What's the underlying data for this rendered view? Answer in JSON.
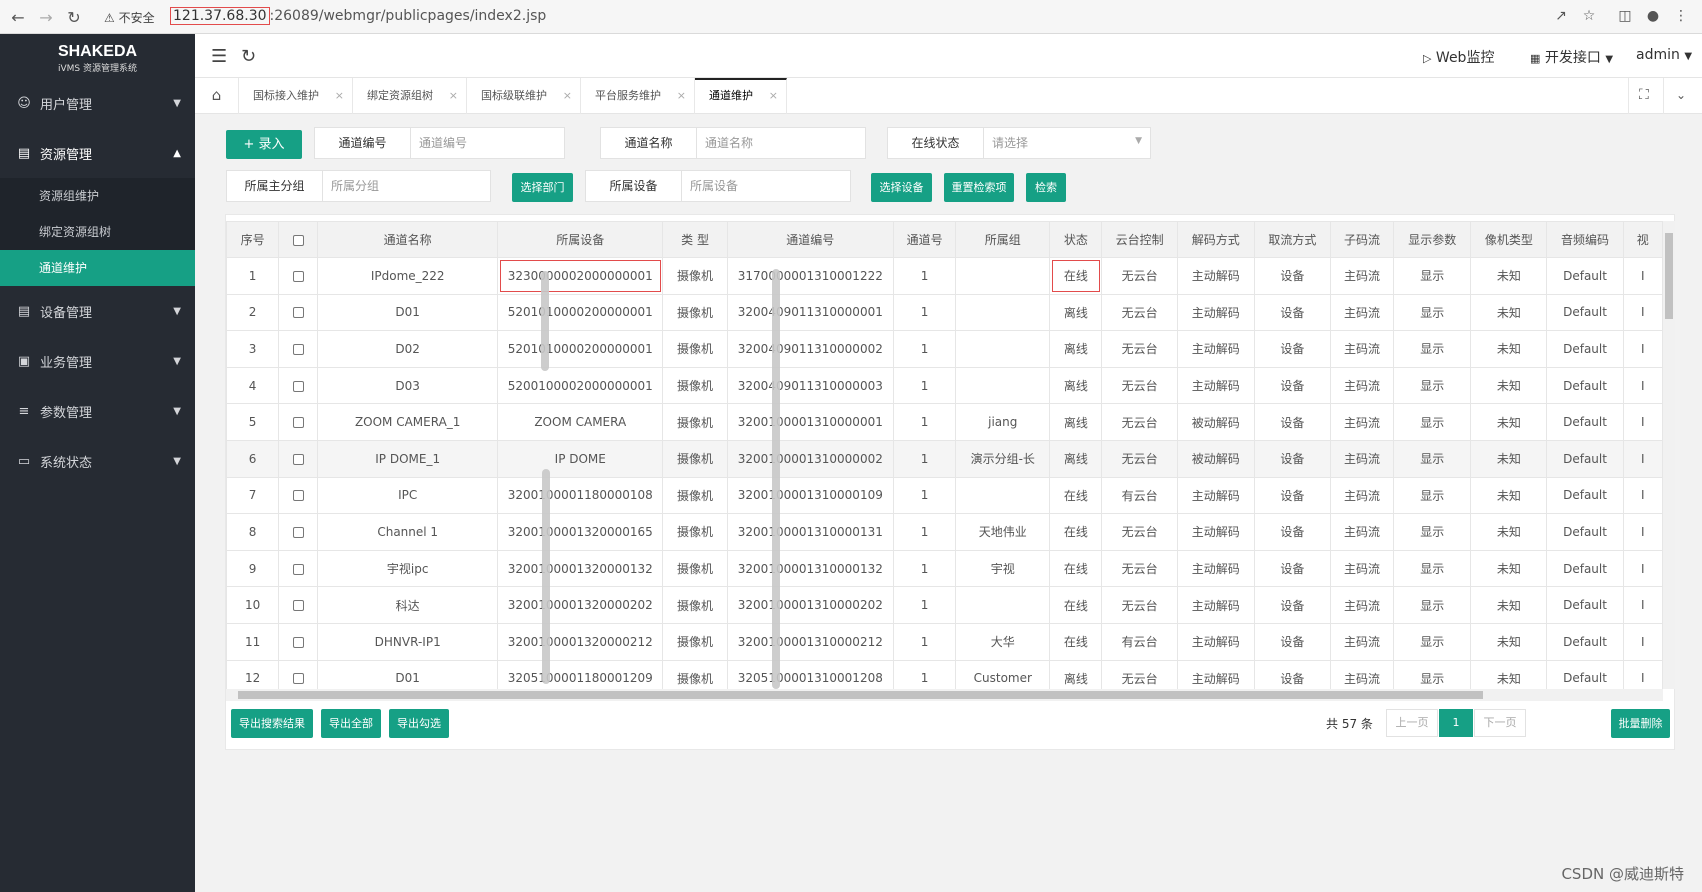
{
  "browser": {
    "back_icon": "arrow-left-icon",
    "forward_icon": "arrow-right-icon",
    "reload_icon": "reload-icon",
    "security_label": "不安全",
    "url_host": "121.37.68.30",
    "url_rest": ":26089/webmgr/publicpages/index2.jsp"
  },
  "sidebar": {
    "logo_main": "SHAKEDA",
    "logo_sub": "iVMS 资源管理系统",
    "items": [
      {
        "label": "用户管理",
        "icon": "user-icon"
      },
      {
        "label": "资源管理",
        "icon": "folder-icon"
      },
      {
        "label": "设备管理",
        "icon": "device-icon"
      },
      {
        "label": "业务管理",
        "icon": "business-icon"
      },
      {
        "label": "参数管理",
        "icon": "sliders-icon"
      },
      {
        "label": "系统状态",
        "icon": "monitor-icon"
      }
    ],
    "subitems": [
      "资源组维护",
      "绑定资源组树",
      "通道维护"
    ],
    "active_sub": "通道维护"
  },
  "topbar": {
    "web_monitor": "Web监控",
    "dev_interface": "开发接口",
    "user": "admin"
  },
  "tabs": [
    "国标接入维护",
    "绑定资源组树",
    "国标级联维护",
    "平台服务维护",
    "通道维护"
  ],
  "active_tab": "通道维护",
  "filters": {
    "add_button": "+ 录入",
    "channel_no_label": "通道编号",
    "channel_no_placeholder": "通道编号",
    "channel_name_label": "通道名称",
    "channel_name_placeholder": "通道名称",
    "online_label": "在线状态",
    "online_placeholder": "请选择",
    "group_label": "所属主分组",
    "group_placeholder": "所属分组",
    "select_dept": "选择部门",
    "device_label": "所属设备",
    "device_placeholder": "所属设备",
    "select_device": "选择设备",
    "reset": "重置检索项",
    "search": "检索"
  },
  "table": {
    "headers": [
      "序号",
      "",
      "通道名称",
      "所属设备",
      "类 型",
      "通道编号",
      "通道号",
      "所属组",
      "状态",
      "云台控制",
      "解码方式",
      "取流方式",
      "子码流",
      "显示参数",
      "像机类型",
      "音频编码",
      "视"
    ],
    "rows": [
      [
        "1",
        "",
        "IPdome_222",
        "3230000002000000001",
        "摄像机",
        "3170000001310001222",
        "1",
        "",
        "在线",
        "无云台",
        "主动解码",
        "设备",
        "主码流",
        "显示",
        "未知",
        "Default",
        "I"
      ],
      [
        "2",
        "",
        "D01",
        "5201010000200000001",
        "摄像机",
        "3200409011310000001",
        "1",
        "",
        "离线",
        "无云台",
        "主动解码",
        "设备",
        "主码流",
        "显示",
        "未知",
        "Default",
        "I"
      ],
      [
        "3",
        "",
        "D02",
        "5201010000200000001",
        "摄像机",
        "3200409011310000002",
        "1",
        "",
        "离线",
        "无云台",
        "主动解码",
        "设备",
        "主码流",
        "显示",
        "未知",
        "Default",
        "I"
      ],
      [
        "4",
        "",
        "D03",
        "5200100002000000001",
        "摄像机",
        "3200409011310000003",
        "1",
        "",
        "离线",
        "无云台",
        "主动解码",
        "设备",
        "主码流",
        "显示",
        "未知",
        "Default",
        "I"
      ],
      [
        "5",
        "",
        "ZOOM CAMERA_1",
        "ZOOM CAMERA",
        "摄像机",
        "3200100001310000001",
        "1",
        "jiang",
        "离线",
        "无云台",
        "被动解码",
        "设备",
        "主码流",
        "显示",
        "未知",
        "Default",
        "I"
      ],
      [
        "6",
        "",
        "IP DOME_1",
        "IP DOME",
        "摄像机",
        "3200100001310000002",
        "1",
        "演示分组-长",
        "离线",
        "无云台",
        "被动解码",
        "设备",
        "主码流",
        "显示",
        "未知",
        "Default",
        "I"
      ],
      [
        "7",
        "",
        "IPC",
        "3200100001180000108",
        "摄像机",
        "3200100001310000109",
        "1",
        "",
        "在线",
        "有云台",
        "主动解码",
        "设备",
        "主码流",
        "显示",
        "未知",
        "Default",
        "I"
      ],
      [
        "8",
        "",
        "Channel 1",
        "3200100001320000165",
        "摄像机",
        "3200100001310000131",
        "1",
        "天地伟业",
        "在线",
        "无云台",
        "主动解码",
        "设备",
        "主码流",
        "显示",
        "未知",
        "Default",
        "I"
      ],
      [
        "9",
        "",
        "宇视ipc",
        "3200100001320000132",
        "摄像机",
        "3200100001310000132",
        "1",
        "宇视",
        "在线",
        "无云台",
        "主动解码",
        "设备",
        "主码流",
        "显示",
        "未知",
        "Default",
        "I"
      ],
      [
        "10",
        "",
        "科达",
        "3200100001320000202",
        "摄像机",
        "3200100001310000202",
        "1",
        "",
        "在线",
        "无云台",
        "主动解码",
        "设备",
        "主码流",
        "显示",
        "未知",
        "Default",
        "I"
      ],
      [
        "11",
        "",
        "DHNVR-IP1",
        "3200100001320000212",
        "摄像机",
        "3200100001310000212",
        "1",
        "大华",
        "在线",
        "有云台",
        "主动解码",
        "设备",
        "主码流",
        "显示",
        "未知",
        "Default",
        "I"
      ],
      [
        "12",
        "",
        "D01",
        "3205100001180001209",
        "摄像机",
        "3205100001310001208",
        "1",
        "Customer",
        "离线",
        "无云台",
        "主动解码",
        "设备",
        "主码流",
        "显示",
        "未知",
        "Default",
        "I"
      ]
    ]
  },
  "footer": {
    "export_search": "导出搜索结果",
    "export_all": "导出全部",
    "export_checked": "导出勾选",
    "total": "共 57 条",
    "prev": "上一页",
    "page": "1",
    "next": "下一页",
    "batch_delete": "批量删除"
  },
  "watermark": "CSDN @威迪斯特"
}
